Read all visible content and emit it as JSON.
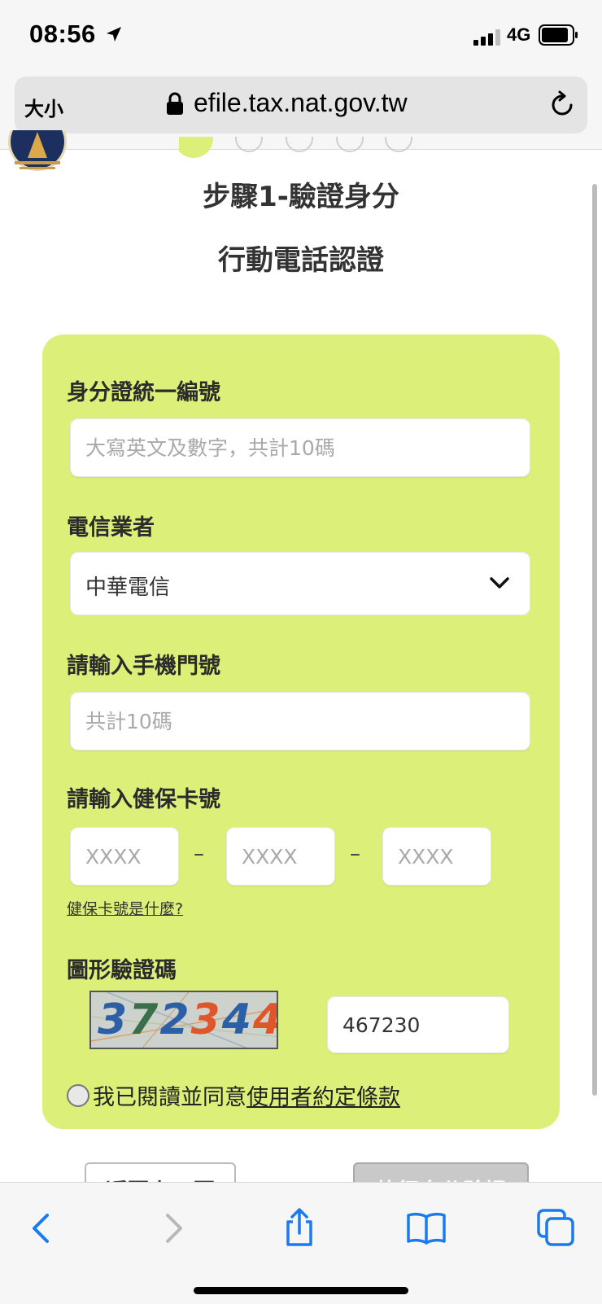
{
  "status_bar": {
    "time": "08:56",
    "network": "4G"
  },
  "browser": {
    "text_size_label": "大小",
    "domain": "efile.tax.nat.gov.tw"
  },
  "page": {
    "step_title": "步驟1-驗證身分",
    "sub_title": "行動電話認證"
  },
  "form": {
    "id_label": "身分證統一編號",
    "id_placeholder": "大寫英文及數字，共計10碼",
    "carrier_label": "電信業者",
    "carrier_value": "中華電信",
    "phone_label": "請輸入手機門號",
    "phone_placeholder": "共計10碼",
    "nhi_label": "請輸入健保卡號",
    "nhi_placeholder": "XXXX",
    "nhi_separator": "–",
    "nhi_help": "健保卡號是什麼?",
    "captcha_label": "圖形驗證碼",
    "captcha_image_text": "372344",
    "captcha_value": "467230",
    "agree_text": "我已閱讀並同意",
    "terms_link": "使用者約定條款"
  },
  "buttons": {
    "back": "返回上一頁",
    "verify": "執行身分驗證"
  },
  "colors": {
    "form_background": "#dcef78",
    "ios_blue": "#1a7bf0"
  },
  "icons": [
    "location-arrow-icon",
    "signal-icon",
    "battery-icon",
    "lock-icon",
    "reload-icon",
    "chevron-down-icon",
    "back-arrow-icon",
    "forward-arrow-icon",
    "share-icon",
    "bookmarks-icon",
    "tabs-icon"
  ]
}
